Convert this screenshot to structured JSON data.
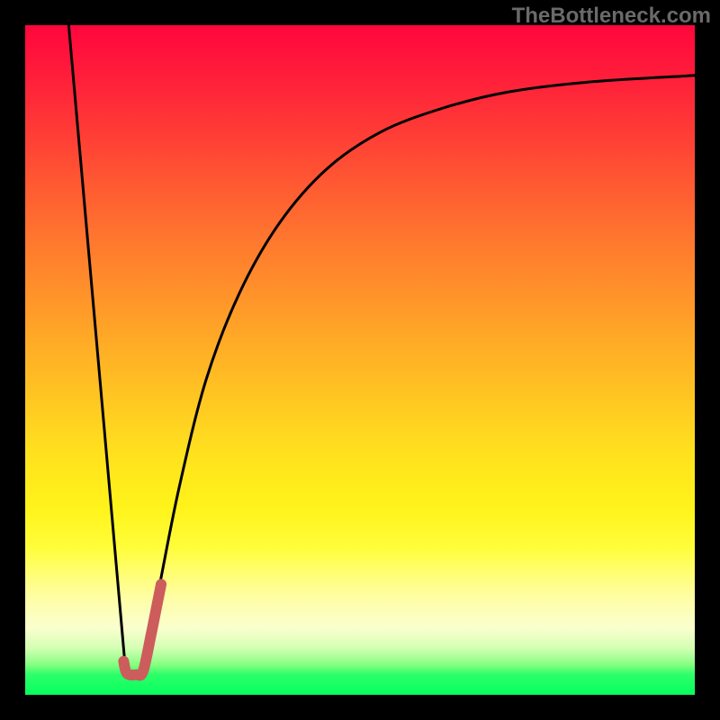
{
  "watermark": "TheBottleneck.com",
  "chart_data": {
    "type": "line",
    "title": "",
    "xlabel": "",
    "ylabel": "",
    "xlim": [
      0,
      100
    ],
    "ylim": [
      0,
      100
    ],
    "grid": false,
    "legend": false,
    "series": [
      {
        "name": "left-ray",
        "type": "line",
        "points": [
          {
            "x": 6.5,
            "y": 100
          },
          {
            "x": 15.0,
            "y": 3.5
          }
        ],
        "stroke": "#000000",
        "stroke_width": 3
      },
      {
        "name": "right-curve",
        "type": "line",
        "points": [
          {
            "x": 17.5,
            "y": 3.5
          },
          {
            "x": 20.0,
            "y": 16.0
          },
          {
            "x": 23.0,
            "y": 31.0
          },
          {
            "x": 27.0,
            "y": 47.0
          },
          {
            "x": 32.0,
            "y": 60.0
          },
          {
            "x": 38.0,
            "y": 70.5
          },
          {
            "x": 45.0,
            "y": 78.5
          },
          {
            "x": 53.0,
            "y": 84.0
          },
          {
            "x": 62.0,
            "y": 87.5
          },
          {
            "x": 72.0,
            "y": 90.0
          },
          {
            "x": 84.0,
            "y": 91.5
          },
          {
            "x": 100.0,
            "y": 92.5
          }
        ],
        "stroke": "#000000",
        "stroke_width": 3
      },
      {
        "name": "highlight-hook",
        "type": "line",
        "points": [
          {
            "x": 14.7,
            "y": 5.0
          },
          {
            "x": 15.2,
            "y": 3.2
          },
          {
            "x": 16.6,
            "y": 3.0
          },
          {
            "x": 17.6,
            "y": 3.5
          },
          {
            "x": 18.8,
            "y": 9.0
          },
          {
            "x": 19.6,
            "y": 13.0
          },
          {
            "x": 20.3,
            "y": 16.5
          }
        ],
        "stroke": "#cd5c5c",
        "stroke_width": 12,
        "linecap": "round"
      }
    ],
    "background_gradient": {
      "direction": "top-to-bottom",
      "stops": [
        {
          "pos": 0.0,
          "color": "#ff063d"
        },
        {
          "pos": 0.5,
          "color": "#ffb424"
        },
        {
          "pos": 0.78,
          "color": "#fffd3a"
        },
        {
          "pos": 0.9,
          "color": "#faffce"
        },
        {
          "pos": 1.0,
          "color": "#07ff5e"
        }
      ]
    }
  }
}
